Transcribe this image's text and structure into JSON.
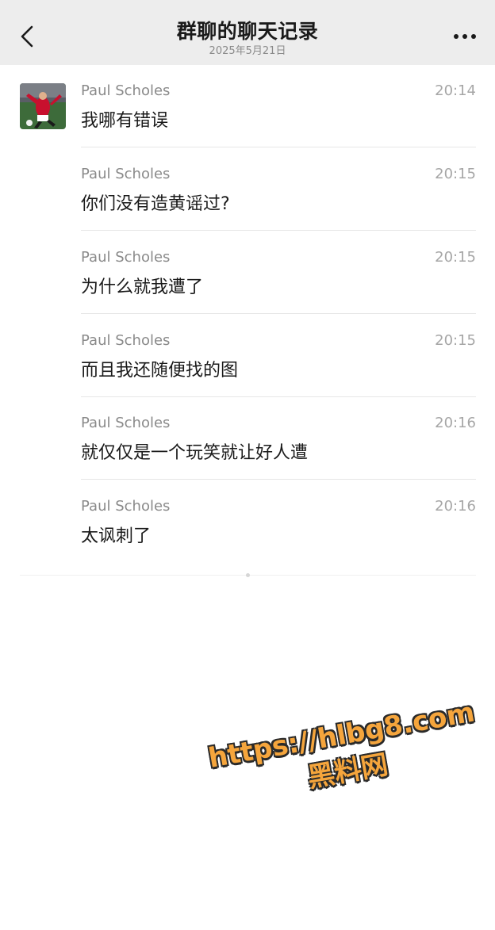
{
  "nav": {
    "title": "群聊的聊天记录",
    "subtitle": "2025年5月21日",
    "back_icon": "chevron-left-icon",
    "more_icon": "more-dots-icon"
  },
  "avatar": {
    "icon": "avatar-photo"
  },
  "messages": [
    {
      "sender": "Paul Scholes",
      "time": "20:14",
      "text": "我哪有错误"
    },
    {
      "sender": "Paul Scholes",
      "time": "20:15",
      "text": "你们没有造黄谣过?"
    },
    {
      "sender": "Paul Scholes",
      "time": "20:15",
      "text": "为什么就我遭了"
    },
    {
      "sender": "Paul Scholes",
      "time": "20:15",
      "text": "而且我还随便找的图"
    },
    {
      "sender": "Paul Scholes",
      "time": "20:16",
      "text": "就仅仅是一个玩笑就让好人遭"
    },
    {
      "sender": "Paul Scholes",
      "time": "20:16",
      "text": "太讽刺了"
    }
  ],
  "watermark": {
    "url": "https://hlbg8.com",
    "label": "黑料网"
  },
  "colors": {
    "nav_bg": "#ededed",
    "sender": "#8a8a8a",
    "time": "#a6a6a6",
    "watermark": "#f5a53c"
  }
}
